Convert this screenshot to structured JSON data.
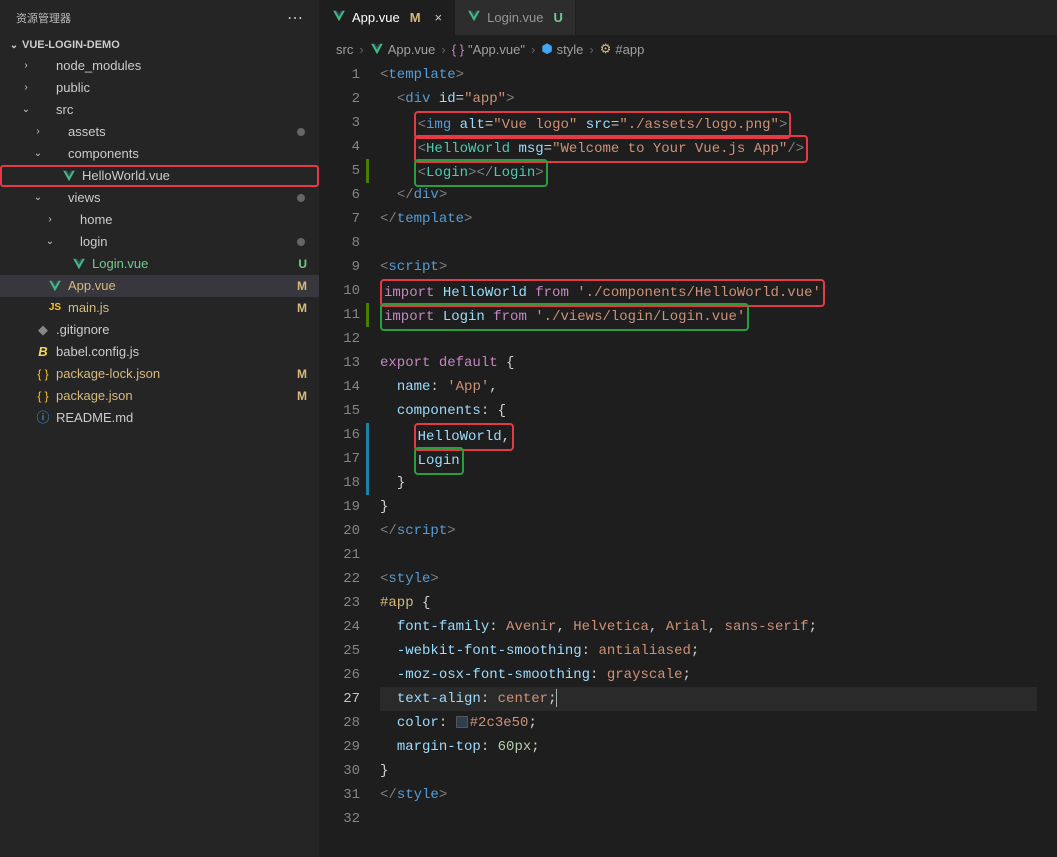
{
  "sidebar": {
    "title": "资源管理器",
    "project": "VUE-LOGIN-DEMO",
    "tree": [
      {
        "label": "node_modules",
        "type": "folder",
        "indent": 1,
        "chevron": "right"
      },
      {
        "label": "public",
        "type": "folder",
        "indent": 1,
        "chevron": "right"
      },
      {
        "label": "src",
        "type": "folder",
        "indent": 1,
        "chevron": "down"
      },
      {
        "label": "assets",
        "type": "folder",
        "indent": 2,
        "chevron": "right",
        "dot": true
      },
      {
        "label": "components",
        "type": "folder",
        "indent": 2,
        "chevron": "down"
      },
      {
        "label": "HelloWorld.vue",
        "type": "vue",
        "indent": 3,
        "highlighted": true
      },
      {
        "label": "views",
        "type": "folder",
        "indent": 2,
        "chevron": "down",
        "dot": true
      },
      {
        "label": "home",
        "type": "folder",
        "indent": 3,
        "chevron": "right"
      },
      {
        "label": "login",
        "type": "folder",
        "indent": 3,
        "chevron": "down",
        "dot": true
      },
      {
        "label": "Login.vue",
        "type": "vue",
        "indent": 4,
        "badge": "U",
        "badgeClass": "untracked"
      },
      {
        "label": "App.vue",
        "type": "vue",
        "indent": 2,
        "badge": "M",
        "badgeClass": "modified",
        "selected": true
      },
      {
        "label": "main.js",
        "type": "js",
        "indent": 2,
        "badge": "M",
        "badgeClass": "modified"
      },
      {
        "label": ".gitignore",
        "type": "git",
        "indent": 1
      },
      {
        "label": "babel.config.js",
        "type": "babel",
        "indent": 1
      },
      {
        "label": "package-lock.json",
        "type": "json",
        "indent": 1,
        "badge": "M",
        "badgeClass": "modified"
      },
      {
        "label": "package.json",
        "type": "json",
        "indent": 1,
        "badge": "M",
        "badgeClass": "modified"
      },
      {
        "label": "README.md",
        "type": "readme",
        "indent": 1
      }
    ]
  },
  "tabs": [
    {
      "label": "App.vue",
      "icon": "vue",
      "status": "M",
      "statusClass": "modified",
      "active": true,
      "closeable": true
    },
    {
      "label": "Login.vue",
      "icon": "vue",
      "status": "U",
      "statusClass": "untracked",
      "active": false
    }
  ],
  "breadcrumb": [
    {
      "label": "src",
      "type": "text"
    },
    {
      "label": "App.vue",
      "type": "vue"
    },
    {
      "label": "\"App.vue\"",
      "type": "braces"
    },
    {
      "label": "style",
      "type": "css"
    },
    {
      "label": "#app",
      "type": "selector"
    }
  ],
  "editor": {
    "currentLine": 27,
    "lines": [
      {
        "n": 1,
        "type": "html",
        "parts": [
          {
            "t": "<",
            "c": "tag-bracket"
          },
          {
            "t": "template",
            "c": "tag-name"
          },
          {
            "t": ">",
            "c": "tag-bracket"
          }
        ]
      },
      {
        "n": 2,
        "type": "html",
        "indent": 1,
        "parts": [
          {
            "t": "<",
            "c": "tag-bracket"
          },
          {
            "t": "div",
            "c": "tag-name"
          },
          {
            "t": " "
          },
          {
            "t": "id",
            "c": "attr-name"
          },
          {
            "t": "="
          },
          {
            "t": "\"app\"",
            "c": "attr-value"
          },
          {
            "t": ">",
            "c": "tag-bracket"
          }
        ]
      },
      {
        "n": 3,
        "type": "html",
        "indent": 2,
        "hlbox": "red",
        "parts": [
          {
            "t": "<",
            "c": "tag-bracket"
          },
          {
            "t": "img",
            "c": "tag-name"
          },
          {
            "t": " "
          },
          {
            "t": "alt",
            "c": "attr-name"
          },
          {
            "t": "="
          },
          {
            "t": "\"Vue logo\"",
            "c": "attr-value"
          },
          {
            "t": " "
          },
          {
            "t": "src",
            "c": "attr-name"
          },
          {
            "t": "="
          },
          {
            "t": "\"./assets/logo.png\"",
            "c": "attr-value"
          },
          {
            "t": ">",
            "c": "tag-bracket"
          }
        ]
      },
      {
        "n": 4,
        "type": "html",
        "indent": 2,
        "hlbox": "red",
        "parts": [
          {
            "t": "<",
            "c": "tag-bracket"
          },
          {
            "t": "HelloWorld",
            "c": "component-name"
          },
          {
            "t": " "
          },
          {
            "t": "msg",
            "c": "attr-name"
          },
          {
            "t": "="
          },
          {
            "t": "\"Welcome to Your Vue.js App\"",
            "c": "attr-value"
          },
          {
            "t": "/>",
            "c": "tag-bracket"
          }
        ]
      },
      {
        "n": 5,
        "type": "html",
        "indent": 2,
        "marker": "green",
        "hlbox": "green",
        "parts": [
          {
            "t": "<",
            "c": "tag-bracket"
          },
          {
            "t": "Login",
            "c": "component-name"
          },
          {
            "t": ">",
            "c": "tag-bracket"
          },
          {
            "t": "</",
            "c": "tag-bracket"
          },
          {
            "t": "Login",
            "c": "component-name"
          },
          {
            "t": ">",
            "c": "tag-bracket"
          }
        ]
      },
      {
        "n": 6,
        "type": "html",
        "indent": 1,
        "parts": [
          {
            "t": "</",
            "c": "tag-bracket"
          },
          {
            "t": "div",
            "c": "tag-name"
          },
          {
            "t": ">",
            "c": "tag-bracket"
          }
        ]
      },
      {
        "n": 7,
        "type": "html",
        "parts": [
          {
            "t": "</",
            "c": "tag-bracket"
          },
          {
            "t": "template",
            "c": "tag-name"
          },
          {
            "t": ">",
            "c": "tag-bracket"
          }
        ]
      },
      {
        "n": 8,
        "type": "blank",
        "parts": []
      },
      {
        "n": 9,
        "type": "html",
        "parts": [
          {
            "t": "<",
            "c": "tag-bracket"
          },
          {
            "t": "script",
            "c": "tag-name"
          },
          {
            "t": ">",
            "c": "tag-bracket"
          }
        ]
      },
      {
        "n": 10,
        "type": "js",
        "hlbox": "red",
        "parts": [
          {
            "t": "import",
            "c": "keyword"
          },
          {
            "t": " "
          },
          {
            "t": "HelloWorld",
            "c": "identifier"
          },
          {
            "t": " "
          },
          {
            "t": "from",
            "c": "keyword"
          },
          {
            "t": " "
          },
          {
            "t": "'./components/HelloWorld.vue'",
            "c": "string"
          }
        ]
      },
      {
        "n": 11,
        "type": "js",
        "marker": "green",
        "hlbox": "green",
        "parts": [
          {
            "t": "import",
            "c": "keyword"
          },
          {
            "t": " "
          },
          {
            "t": "Login",
            "c": "identifier"
          },
          {
            "t": " "
          },
          {
            "t": "from",
            "c": "keyword"
          },
          {
            "t": " "
          },
          {
            "t": "'./views/login/Login.vue'",
            "c": "string"
          }
        ]
      },
      {
        "n": 12,
        "type": "blank",
        "parts": []
      },
      {
        "n": 13,
        "type": "js",
        "parts": [
          {
            "t": "export",
            "c": "keyword"
          },
          {
            "t": " "
          },
          {
            "t": "default",
            "c": "keyword"
          },
          {
            "t": " "
          },
          {
            "t": "{",
            "c": "brace"
          }
        ]
      },
      {
        "n": 14,
        "type": "js",
        "indent": 1,
        "parts": [
          {
            "t": "name",
            "c": "property"
          },
          {
            "t": ": "
          },
          {
            "t": "'App'",
            "c": "string"
          },
          {
            "t": ",",
            "c": "punctuation"
          }
        ]
      },
      {
        "n": 15,
        "type": "js",
        "indent": 1,
        "parts": [
          {
            "t": "components",
            "c": "property"
          },
          {
            "t": ": "
          },
          {
            "t": "{",
            "c": "brace"
          }
        ]
      },
      {
        "n": 16,
        "type": "js",
        "indent": 2,
        "marker": "blue",
        "hlbox": "red",
        "parts": [
          {
            "t": "HelloWorld",
            "c": "identifier"
          },
          {
            "t": ",",
            "c": "punctuation"
          }
        ]
      },
      {
        "n": 17,
        "type": "js",
        "indent": 2,
        "marker": "blue",
        "hlbox": "green",
        "parts": [
          {
            "t": "Login",
            "c": "identifier"
          }
        ]
      },
      {
        "n": 18,
        "type": "js",
        "indent": 1,
        "marker": "blue",
        "parts": [
          {
            "t": "}",
            "c": "brace"
          }
        ]
      },
      {
        "n": 19,
        "type": "js",
        "parts": [
          {
            "t": "}",
            "c": "brace"
          }
        ]
      },
      {
        "n": 20,
        "type": "html",
        "parts": [
          {
            "t": "</",
            "c": "tag-bracket"
          },
          {
            "t": "script",
            "c": "tag-name"
          },
          {
            "t": ">",
            "c": "tag-bracket"
          }
        ]
      },
      {
        "n": 21,
        "type": "blank",
        "parts": []
      },
      {
        "n": 22,
        "type": "html",
        "parts": [
          {
            "t": "<",
            "c": "tag-bracket"
          },
          {
            "t": "style",
            "c": "tag-name"
          },
          {
            "t": ">",
            "c": "tag-bracket"
          }
        ]
      },
      {
        "n": 23,
        "type": "css",
        "parts": [
          {
            "t": "#app",
            "c": "css-selector"
          },
          {
            "t": " "
          },
          {
            "t": "{",
            "c": "brace"
          }
        ]
      },
      {
        "n": 24,
        "type": "css",
        "indent": 1,
        "parts": [
          {
            "t": "font-family",
            "c": "css-prop"
          },
          {
            "t": ": "
          },
          {
            "t": "Avenir",
            "c": "css-value"
          },
          {
            "t": ", "
          },
          {
            "t": "Helvetica",
            "c": "css-value"
          },
          {
            "t": ", "
          },
          {
            "t": "Arial",
            "c": "css-value"
          },
          {
            "t": ", "
          },
          {
            "t": "sans-serif",
            "c": "css-value"
          },
          {
            "t": ";",
            "c": "punctuation"
          }
        ]
      },
      {
        "n": 25,
        "type": "css",
        "indent": 1,
        "parts": [
          {
            "t": "-webkit-font-smoothing",
            "c": "css-prop"
          },
          {
            "t": ": "
          },
          {
            "t": "antialiased",
            "c": "css-value"
          },
          {
            "t": ";",
            "c": "punctuation"
          }
        ]
      },
      {
        "n": 26,
        "type": "css",
        "indent": 1,
        "parts": [
          {
            "t": "-moz-osx-font-smoothing",
            "c": "css-prop"
          },
          {
            "t": ": "
          },
          {
            "t": "grayscale",
            "c": "css-value"
          },
          {
            "t": ";",
            "c": "punctuation"
          }
        ]
      },
      {
        "n": 27,
        "type": "css",
        "indent": 1,
        "current": true,
        "parts": [
          {
            "t": "text-align",
            "c": "css-prop"
          },
          {
            "t": ": "
          },
          {
            "t": "center",
            "c": "css-value"
          },
          {
            "t": ";",
            "c": "punctuation"
          },
          {
            "t": "",
            "cursor": true
          }
        ]
      },
      {
        "n": 28,
        "type": "css",
        "indent": 1,
        "parts": [
          {
            "t": "color",
            "c": "css-prop"
          },
          {
            "t": ": "
          },
          {
            "swatch": "#2c3e50"
          },
          {
            "t": "#2c3e50",
            "c": "css-value"
          },
          {
            "t": ";",
            "c": "punctuation"
          }
        ]
      },
      {
        "n": 29,
        "type": "css",
        "indent": 1,
        "parts": [
          {
            "t": "margin-top",
            "c": "css-prop"
          },
          {
            "t": ": "
          },
          {
            "t": "60px",
            "c": "number"
          },
          {
            "t": ";",
            "c": "punctuation"
          }
        ]
      },
      {
        "n": 30,
        "type": "css",
        "parts": [
          {
            "t": "}",
            "c": "brace"
          }
        ]
      },
      {
        "n": 31,
        "type": "html",
        "parts": [
          {
            "t": "</",
            "c": "tag-bracket"
          },
          {
            "t": "style",
            "c": "tag-name"
          },
          {
            "t": ">",
            "c": "tag-bracket"
          }
        ]
      },
      {
        "n": 32,
        "type": "blank",
        "parts": []
      }
    ]
  }
}
